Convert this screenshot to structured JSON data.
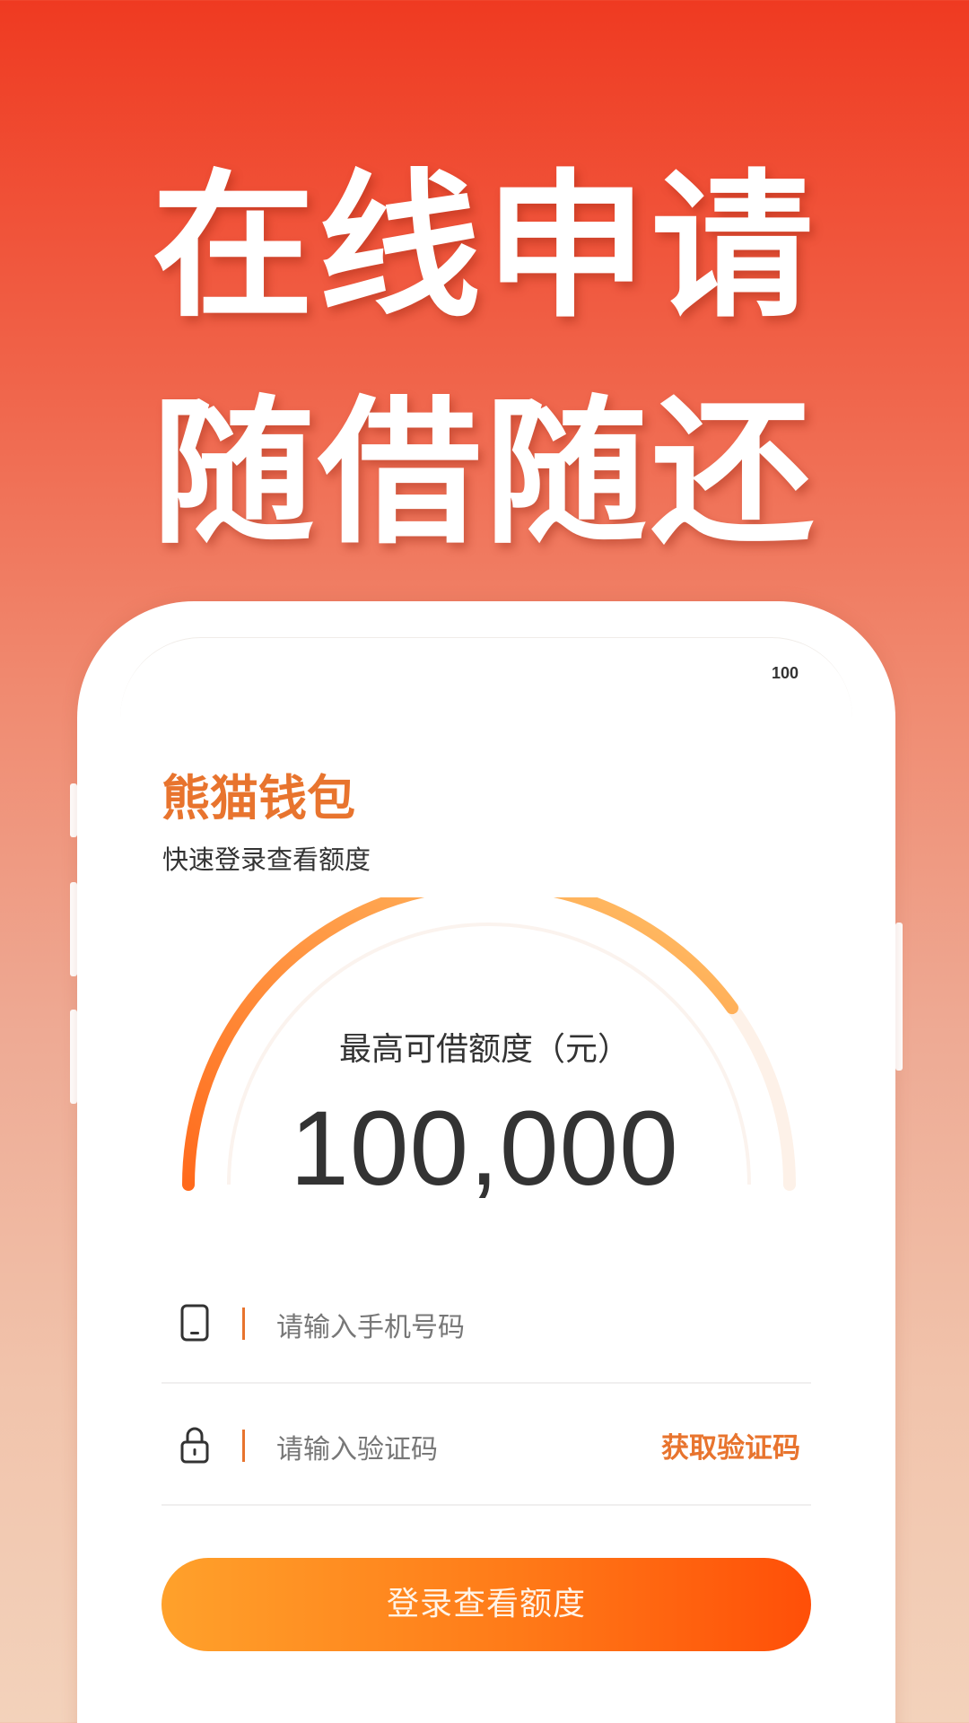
{
  "headline": {
    "line1": "在线申请",
    "line2": "随借随还"
  },
  "status_bar": {
    "battery": "100"
  },
  "app": {
    "brand": "熊猫钱包",
    "subtitle": "快速登录查看额度"
  },
  "gauge": {
    "label": "最高可借额度（元）",
    "value": "100,000",
    "progress_fraction": 0.8,
    "colors": {
      "start": "#ff6a1c",
      "end": "#ffc36a",
      "track": "#fdf1e8"
    }
  },
  "form": {
    "phone": {
      "icon": "phone-icon",
      "placeholder": "请输入手机号码"
    },
    "code": {
      "icon": "lock-icon",
      "placeholder": "请输入验证码",
      "get_code_label": "获取验证码"
    },
    "submit_label": "登录查看额度"
  },
  "colors": {
    "accent": "#e8742e",
    "button_start": "#ffa12b",
    "button_end": "#ff4f08",
    "background_top": "#ef3a21"
  }
}
